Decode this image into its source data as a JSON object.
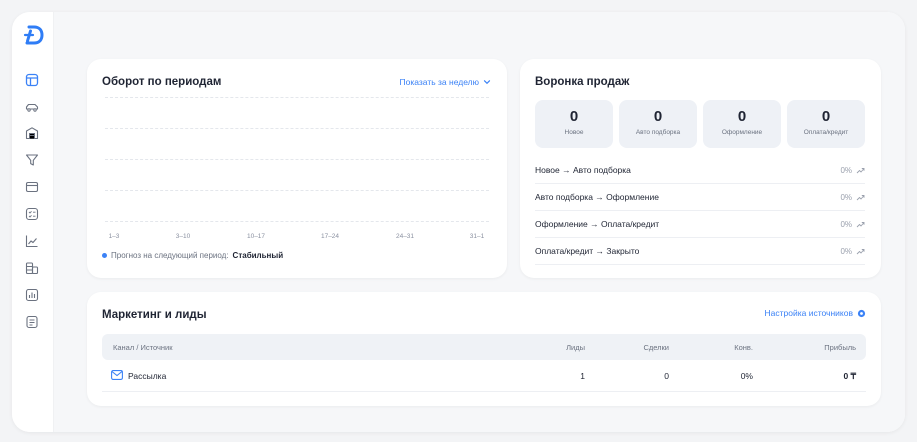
{
  "sidebar": {
    "logo_icon": "brand-logo-icon",
    "items": [
      {
        "icon": "dashboard-icon"
      },
      {
        "icon": "car-icon"
      },
      {
        "icon": "warehouse-icon"
      },
      {
        "icon": "funnel-filter-icon"
      },
      {
        "icon": "card-icon"
      },
      {
        "icon": "checklist-icon"
      },
      {
        "icon": "trend-chart-icon"
      },
      {
        "icon": "coins-icon"
      },
      {
        "icon": "bar-report-icon"
      },
      {
        "icon": "document-icon"
      }
    ]
  },
  "turnover": {
    "title": "Оборот по периодам",
    "period_link": "Показать за неделю",
    "ticks": [
      "1–3",
      "3–10",
      "10–17",
      "17–24",
      "24–31",
      "31–1"
    ],
    "forecast_label": "Прогноз на следующий период:",
    "forecast_value": "Стабильный"
  },
  "funnel": {
    "title": "Воронка продаж",
    "stages": [
      {
        "count": "0",
        "label": "Новое"
      },
      {
        "count": "0",
        "label": "Авто подборка"
      },
      {
        "count": "0",
        "label": "Оформление"
      },
      {
        "count": "0",
        "label": "Оплата/кредит"
      }
    ],
    "conversions": [
      {
        "label": "Новое → Авто подборка",
        "pct": "0%"
      },
      {
        "label": "Авто подборка → Оформление",
        "pct": "0%"
      },
      {
        "label": "Оформление → Оплата/кредит",
        "pct": "0%"
      },
      {
        "label": "Оплата/кредит → Закрыто",
        "pct": "0%"
      }
    ]
  },
  "marketing": {
    "title": "Маркетинг и лиды",
    "sources_link": "Настройка источников",
    "columns": [
      "Канал / Источник",
      "Лиды",
      "Сделки",
      "Конв.",
      "Прибыль"
    ],
    "rows": [
      {
        "channel": "Рассылка",
        "leads": "1",
        "deals": "0",
        "conv": "0%",
        "profit": "0 ₸"
      }
    ]
  },
  "colors": {
    "accent": "#3b82f6",
    "text": "#1f2433",
    "muted": "#6b7280",
    "background": "#f6f7f9"
  }
}
